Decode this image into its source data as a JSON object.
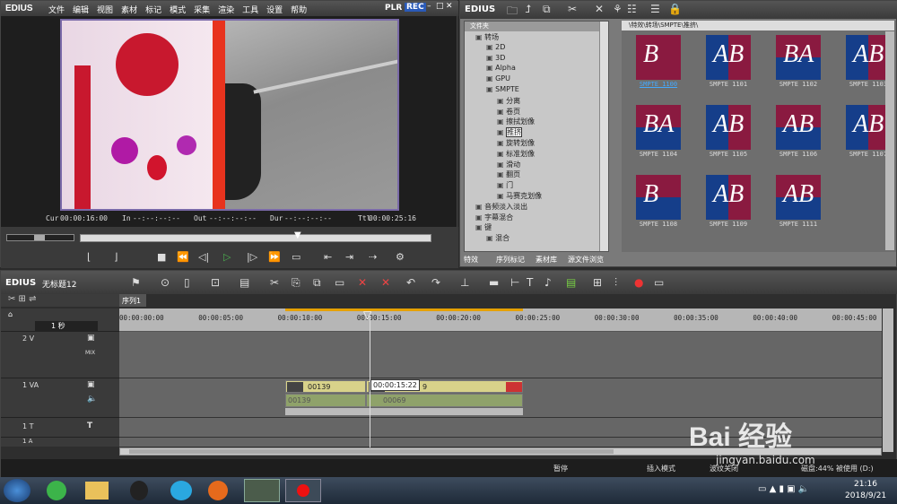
{
  "player": {
    "logo": "EDIUS",
    "menu": [
      "文件",
      "编辑",
      "视图",
      "素材",
      "标记",
      "模式",
      "采集",
      "渲染",
      "工具",
      "设置",
      "帮助"
    ],
    "plr": "PLR",
    "rec": "REC",
    "cur_label": "Cur",
    "cur_val": "00:00:16:00",
    "in_label": "In",
    "in_val": "--:--:--:--",
    "out_label": "Out",
    "out_val": "--:--:--:--",
    "dur_label": "Dur",
    "dur_val": "--:--:--:--",
    "ttl_label": "Ttl",
    "ttl_val": "00:00:25:16"
  },
  "library": {
    "logo": "EDIUS",
    "folder_header": "文件夹",
    "path": "\\特效\\转场\\SMPTE\\推挤\\",
    "tree": [
      "转场",
      "2D",
      "3D",
      "Alpha",
      "GPU",
      "SMPTE",
      "分离",
      "卷页",
      "擦拭划像",
      "推挤",
      "旋转划像",
      "标准划像",
      "滑动",
      "翻页",
      "门",
      "马赛克划像",
      "音频淡入淡出",
      "字幕混合",
      "键",
      "混合"
    ],
    "thumbs": [
      "SMPTE 1100",
      "SMPTE 1101",
      "SMPTE 1102",
      "SMPTE 1103",
      "SMPTE 1104",
      "SMPTE 1105",
      "SMPTE 1106",
      "SMPTE 1107",
      "SMPTE 1108",
      "SMPTE 1109",
      "SMPTE 1111"
    ],
    "tabs": [
      "特效",
      "序列标记",
      "素材库",
      "源文件浏览"
    ]
  },
  "timeline": {
    "logo": "EDIUS",
    "project": "无标题12",
    "sequence_tab": "序列1",
    "scale": "1 秒",
    "ruler": [
      "00:00:00:00",
      "00:00:05:00",
      "00:00:10:00",
      "00:00:15:00",
      "00:00:20:00",
      "00:00:25:00",
      "00:00:30:00",
      "00:00:35:00",
      "00:00:40:00",
      "00:00:45:00"
    ],
    "tracks": {
      "v2": "2 V",
      "mix": "MIX",
      "va1": "1 VA",
      "t1": "1 T",
      "a1": "1 A"
    },
    "clips": {
      "c1": "00139",
      "c1b": "00139",
      "c2": "00069",
      "c3": "9"
    },
    "tooltip": "00:00:15:22",
    "status": {
      "pause": "暂停",
      "insert": "插入模式",
      "ripple": "波纹关闭",
      "disk": "磁盘:44% 被使用 (D:)"
    }
  },
  "watermark": {
    "text": "Bai  经验",
    "url": "jingyan.baidu.com"
  },
  "taskbar": {
    "time": "21:16",
    "date": "2018/9/21"
  }
}
